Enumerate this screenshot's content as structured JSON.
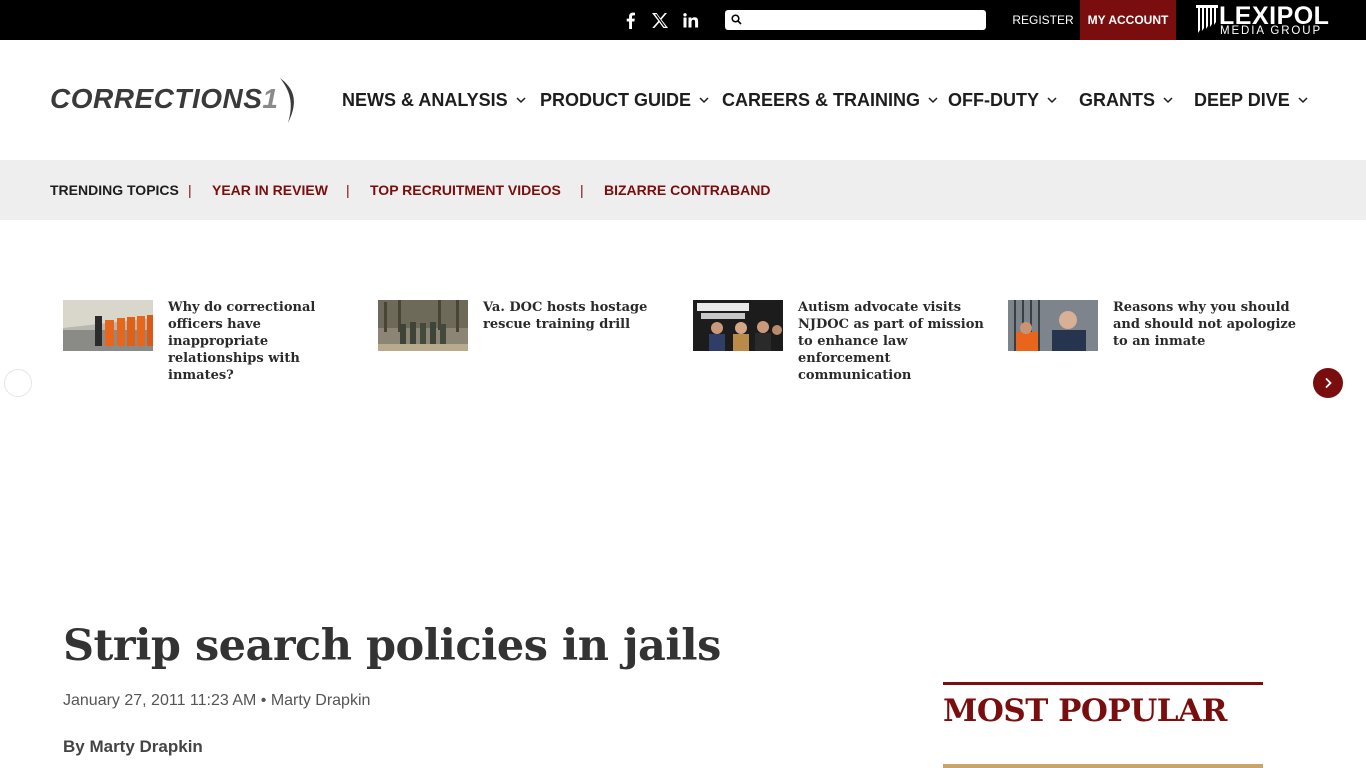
{
  "topbar": {
    "social": [
      "facebook-icon",
      "x-icon",
      "linkedin-icon"
    ],
    "search": {
      "value": "",
      "placeholder": ""
    },
    "register_label": "REGISTER",
    "account_label": "MY ACCOUNT",
    "brand": {
      "name": "LEXIPOL",
      "sub": "MEDIA GROUP"
    }
  },
  "header": {
    "logo": {
      "main": "CORRECTIONS",
      "num": "1"
    },
    "nav": [
      {
        "label": "NEWS & ANALYSIS"
      },
      {
        "label": "PRODUCT GUIDE"
      },
      {
        "label": "CAREERS & TRAINING"
      },
      {
        "label": "OFF-DUTY"
      },
      {
        "label": "GRANTS"
      },
      {
        "label": "DEEP DIVE"
      }
    ]
  },
  "trending": {
    "label": "TRENDING TOPICS",
    "items": [
      "YEAR IN REVIEW",
      "TOP RECRUITMENT VIDEOS",
      "BIZARRE CONTRABAND"
    ]
  },
  "carousel": {
    "cards": [
      {
        "title": "Why do correctional officers have inappropriate relationships with inmates?"
      },
      {
        "title": "Va. DOC hosts hostage rescue training drill"
      },
      {
        "title": "Autism advocate visits NJDOC as part of mission to enhance law enforcement communication"
      },
      {
        "title": "Reasons why you should and should not apologize to an inmate"
      }
    ]
  },
  "article": {
    "title": "Strip search policies in jails",
    "meta": "January 27, 2011 11:23 AM • Marty Drapkin",
    "byline": "By Marty Drapkin"
  },
  "sidebar": {
    "most_popular": "MOST POPULAR"
  },
  "colors": {
    "accent": "#7a0d0d",
    "topbar": "#000000",
    "trend_bg": "#eeeeee"
  }
}
